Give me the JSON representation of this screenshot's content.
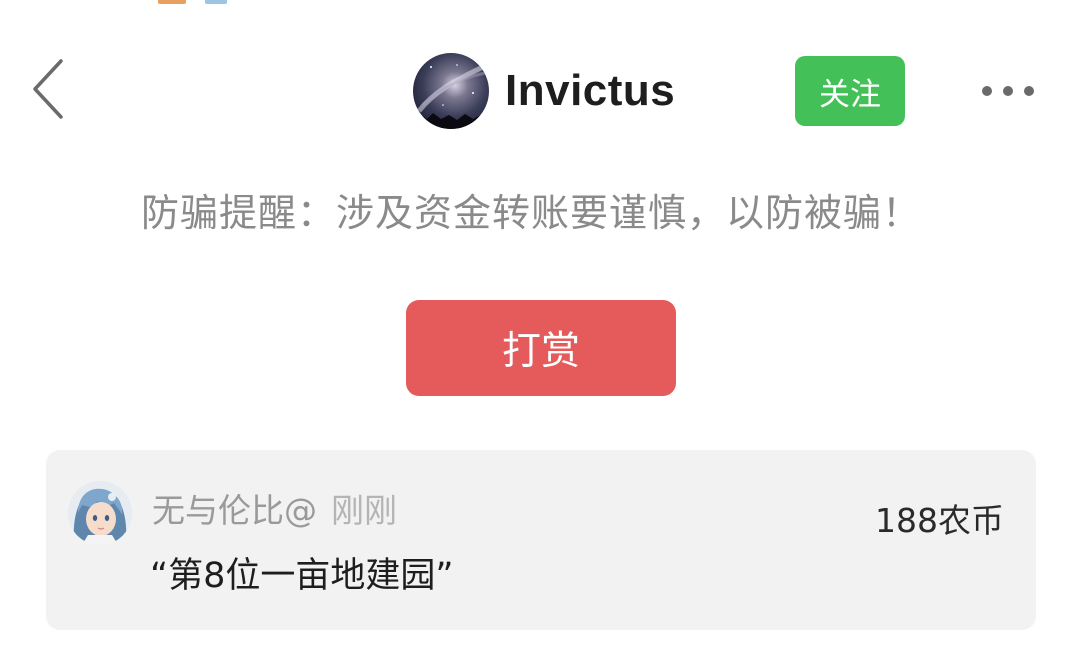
{
  "header": {
    "back_icon": "chevron-left-icon",
    "username": "Invictus",
    "follow_label": "关注",
    "follow_color": "#44c058",
    "more_icon": "more-horizontal-icon"
  },
  "warning_text": "防骗提醒：涉及资金转账要谨慎，以防被骗！",
  "tip_button": {
    "label": "打赏",
    "color": "#e55a5a"
  },
  "reward": {
    "username": "无与伦比@",
    "time": "刚刚",
    "message": "“第8位一亩地建园”",
    "amount": "188农币"
  }
}
